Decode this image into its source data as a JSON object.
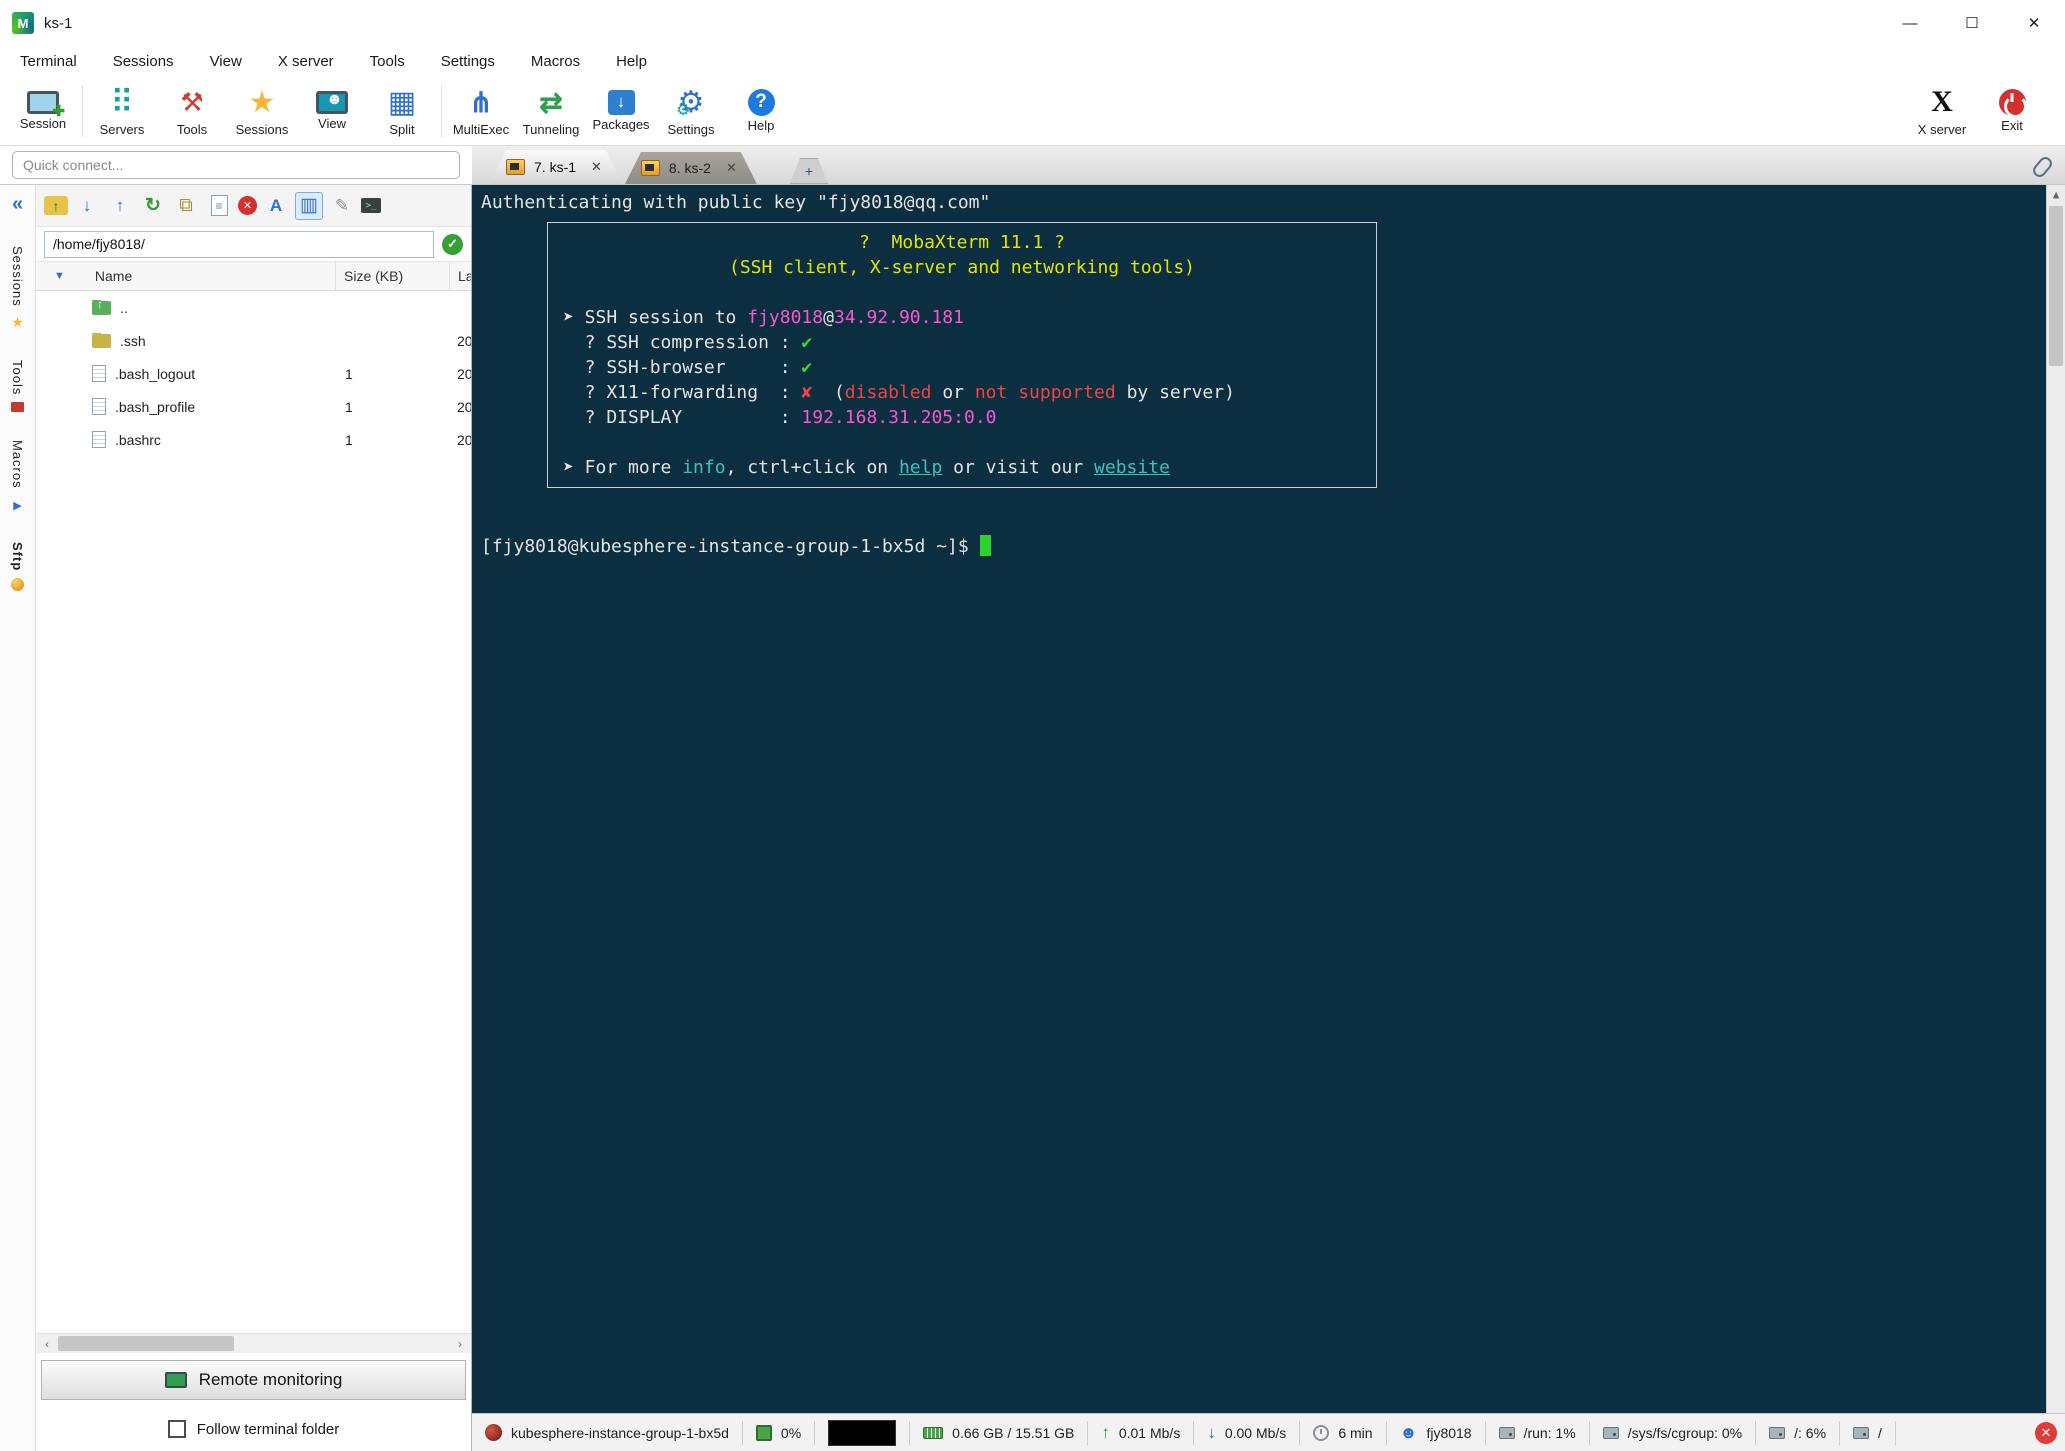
{
  "window": {
    "title": "ks-1",
    "minimize": "—",
    "maximize": "☐",
    "close": "✕"
  },
  "menu": [
    "Terminal",
    "Sessions",
    "View",
    "X server",
    "Tools",
    "Settings",
    "Macros",
    "Help"
  ],
  "toolbar": {
    "buttons": [
      {
        "id": "session",
        "label": "Session"
      },
      {
        "id": "servers",
        "label": "Servers"
      },
      {
        "id": "tools",
        "label": "Tools"
      },
      {
        "id": "sessions",
        "label": "Sessions"
      },
      {
        "id": "view",
        "label": "View"
      },
      {
        "id": "split",
        "label": "Split"
      },
      {
        "id": "multiexec",
        "label": "MultiExec"
      },
      {
        "id": "tunneling",
        "label": "Tunneling"
      },
      {
        "id": "packages",
        "label": "Packages"
      },
      {
        "id": "settings",
        "label": "Settings"
      },
      {
        "id": "help",
        "label": "Help"
      }
    ],
    "right_buttons": [
      {
        "id": "xserver",
        "label": "X server"
      },
      {
        "id": "exit",
        "label": "Exit"
      }
    ]
  },
  "quick_connect": {
    "placeholder": "Quick connect..."
  },
  "tabs": {
    "items": [
      {
        "label": "7. ks-1",
        "active": true
      },
      {
        "label": "8. ks-2",
        "active": false
      }
    ],
    "close_glyph": "✕",
    "add_glyph": "+"
  },
  "side_strip": {
    "collapse_glyph": "«",
    "tabs": [
      {
        "label": "Sessions",
        "icon": "star",
        "active": false
      },
      {
        "label": "Tools",
        "icon": "toolbox",
        "active": false
      },
      {
        "label": "Macros",
        "icon": "macro",
        "active": false
      },
      {
        "label": "Sftp",
        "icon": "sftp",
        "active": true
      }
    ]
  },
  "sftp": {
    "toolbar_icons": [
      "parent-folder",
      "download",
      "upload",
      "refresh",
      "copy",
      "new-file",
      "delete",
      "rename",
      "columns",
      "wand",
      "console"
    ],
    "selected_icon": "columns",
    "path": "/home/fjy8018/",
    "columns": {
      "name": "Name",
      "size": "Size (KB)",
      "modified": "La"
    },
    "rows": [
      {
        "name": "..",
        "size": "",
        "modified": "",
        "icon": "folder-up"
      },
      {
        "name": ".ssh",
        "size": "",
        "modified": "20",
        "icon": "folder"
      },
      {
        "name": ".bash_logout",
        "size": "1",
        "modified": "20",
        "icon": "file"
      },
      {
        "name": ".bash_profile",
        "size": "1",
        "modified": "20",
        "icon": "file"
      },
      {
        "name": ".bashrc",
        "size": "1",
        "modified": "20",
        "icon": "file"
      }
    ],
    "remote_monitoring_label": "Remote monitoring",
    "follow_label": "Follow terminal folder",
    "follow_checked": false
  },
  "terminal": {
    "auth_line": "Authenticating with public key \"fjy8018@qq.com\"",
    "banner": [
      {
        "align": "center",
        "segments": [
          {
            "t": "?  MobaXterm 11.1 ?",
            "c": "yellow"
          }
        ]
      },
      {
        "align": "center",
        "segments": [
          {
            "t": "(SSH client, X-server and networking tools)",
            "c": "yellow"
          }
        ]
      },
      {
        "segments": []
      },
      {
        "segments": [
          {
            "t": "➤ SSH session to ",
            "c": "fg"
          },
          {
            "t": "fjy8018",
            "c": "magenta"
          },
          {
            "t": "@",
            "c": "fg"
          },
          {
            "t": "34.92.90.181",
            "c": "magenta"
          }
        ]
      },
      {
        "segments": [
          {
            "t": "  ? SSH compression : ",
            "c": "fg"
          },
          {
            "t": "✔",
            "c": "green"
          }
        ]
      },
      {
        "segments": [
          {
            "t": "  ? SSH-browser     : ",
            "c": "fg"
          },
          {
            "t": "✔",
            "c": "green"
          }
        ]
      },
      {
        "segments": [
          {
            "t": "  ? X11-forwarding  : ",
            "c": "fg"
          },
          {
            "t": "✘",
            "c": "red"
          },
          {
            "t": "  (",
            "c": "fg"
          },
          {
            "t": "disabled",
            "c": "red"
          },
          {
            "t": " or ",
            "c": "fg"
          },
          {
            "t": "not supported",
            "c": "red"
          },
          {
            "t": " by server)",
            "c": "fg"
          }
        ]
      },
      {
        "segments": [
          {
            "t": "  ? DISPLAY         : ",
            "c": "fg"
          },
          {
            "t": "192.168.31.205:0.0",
            "c": "magenta"
          }
        ]
      },
      {
        "segments": []
      },
      {
        "segments": [
          {
            "t": "➤ For more ",
            "c": "fg"
          },
          {
            "t": "info",
            "c": "cyan"
          },
          {
            "t": ", ctrl+click on ",
            "c": "fg"
          },
          {
            "t": "help",
            "c": "cyan",
            "u": true
          },
          {
            "t": " or visit our ",
            "c": "fg"
          },
          {
            "t": "website",
            "c": "cyan",
            "u": true
          }
        ]
      }
    ],
    "prompt": "[fjy8018@kubesphere-instance-group-1-bx5d ~]$ "
  },
  "statusbar": {
    "items": [
      {
        "icon": "host",
        "text": "kubesphere-instance-group-1-bx5d"
      },
      {
        "icon": "cpu",
        "text": "0%"
      },
      {
        "icon": "graph",
        "text": ""
      },
      {
        "icon": "ram",
        "text": "0.66 GB / 15.51 GB"
      },
      {
        "icon": "upload",
        "text": "0.01 Mb/s"
      },
      {
        "icon": "download",
        "text": "0.00 Mb/s"
      },
      {
        "icon": "clock",
        "text": "6 min"
      },
      {
        "icon": "user",
        "text": "fjy8018"
      },
      {
        "icon": "disk",
        "text": "/run: 1%"
      },
      {
        "icon": "disk",
        "text": "/sys/fs/cgroup: 0%"
      },
      {
        "icon": "disk",
        "text": "/: 6%"
      },
      {
        "icon": "disk",
        "text": "/"
      }
    ]
  },
  "colors": {
    "terminal_bg": "#0b2e40",
    "accent_blue": "#2a6fd6",
    "link_cyan": "#3ac2c2",
    "ok_green": "#37d837",
    "err_red": "#ef4545",
    "magenta": "#ff55cc",
    "yellow": "#e4e400"
  }
}
